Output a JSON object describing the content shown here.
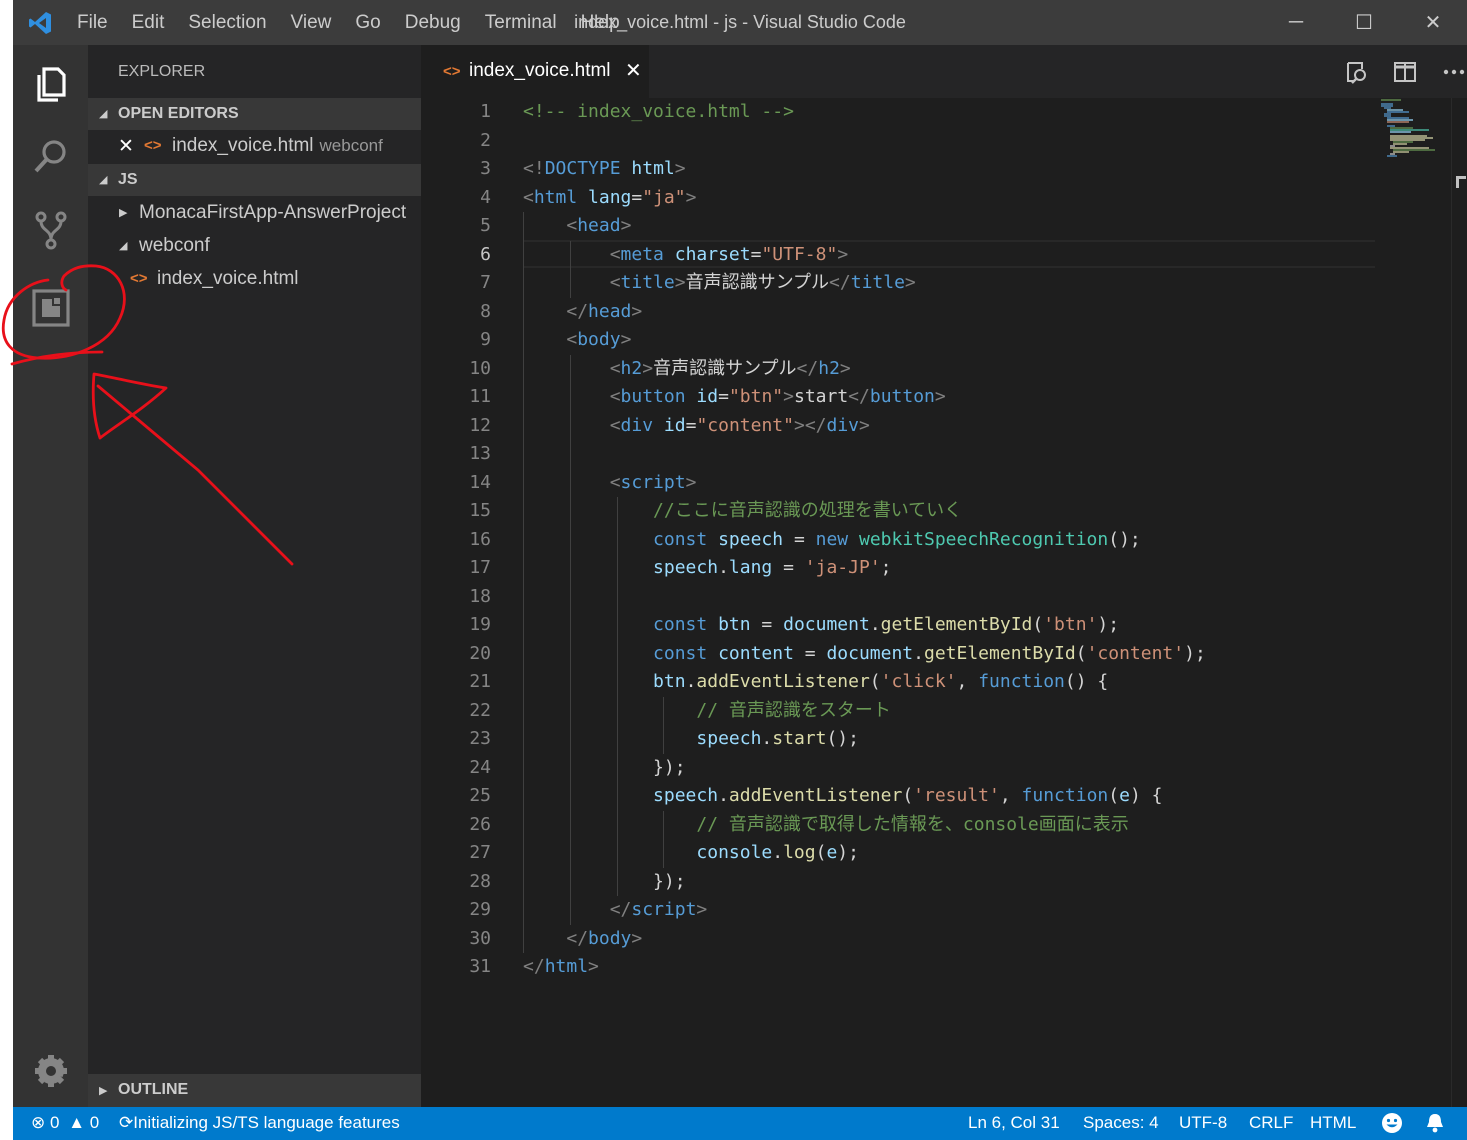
{
  "window": {
    "title": "index_voice.html - js - Visual Studio Code",
    "controls": {
      "minimize": "─",
      "maximize": "☐",
      "close": "✕"
    }
  },
  "menu": [
    "File",
    "Edit",
    "Selection",
    "View",
    "Go",
    "Debug",
    "Terminal",
    "Help"
  ],
  "activity_bar": {
    "items": [
      "explorer-icon",
      "search-icon",
      "source-control-icon",
      "extension-icon"
    ],
    "bottom": "gear-icon"
  },
  "sidebar": {
    "title": "EXPLORER",
    "open_editors": {
      "header": "OPEN EDITORS",
      "file": "index_voice.html",
      "folder": "webconf"
    },
    "workspace": {
      "header": "JS",
      "items": [
        {
          "label": "MonacaFirstApp-AnswerProject"
        },
        {
          "label": "webconf"
        },
        {
          "label": "index_voice.html"
        }
      ]
    },
    "outline": "OUTLINE"
  },
  "tab": {
    "label": "index_voice.html",
    "close": "✕",
    "file_icon": "<>"
  },
  "editor": {
    "current_line": 6,
    "line_numbers": [
      "1",
      "2",
      "3",
      "4",
      "5",
      "6",
      "7",
      "8",
      "9",
      "10",
      "11",
      "12",
      "13",
      "14",
      "15",
      "16",
      "17",
      "18",
      "19",
      "20",
      "21",
      "22",
      "23",
      "24",
      "25",
      "26",
      "27",
      "28",
      "29",
      "30",
      "31"
    ],
    "lines": [
      [
        [
          "cm",
          "<!-- index_voice.html -->"
        ]
      ],
      [],
      [
        [
          "tg",
          "<!"
        ],
        [
          "tn",
          "DOCTYPE"
        ],
        [
          "tx",
          " "
        ],
        [
          "at",
          "html"
        ],
        [
          "tg",
          ">"
        ]
      ],
      [
        [
          "tg",
          "<"
        ],
        [
          "tn",
          "html"
        ],
        [
          "tx",
          " "
        ],
        [
          "at",
          "lang"
        ],
        [
          "tx",
          "="
        ],
        [
          "st",
          "\"ja\""
        ],
        [
          "tg",
          ">"
        ]
      ],
      [
        [
          "tx",
          "    "
        ],
        [
          "tg",
          "<"
        ],
        [
          "tn",
          "head"
        ],
        [
          "tg",
          ">"
        ]
      ],
      [
        [
          "tx",
          "        "
        ],
        [
          "tg",
          "<"
        ],
        [
          "tn",
          "meta"
        ],
        [
          "tx",
          " "
        ],
        [
          "at",
          "charset"
        ],
        [
          "tx",
          "="
        ],
        [
          "st",
          "\"UTF-8\""
        ],
        [
          "tg",
          ">"
        ]
      ],
      [
        [
          "tx",
          "        "
        ],
        [
          "tg",
          "<"
        ],
        [
          "tn",
          "title"
        ],
        [
          "tg",
          ">"
        ],
        [
          "tx",
          "音声認識サンプル"
        ],
        [
          "tg",
          "</"
        ],
        [
          "tn",
          "title"
        ],
        [
          "tg",
          ">"
        ]
      ],
      [
        [
          "tx",
          "    "
        ],
        [
          "tg",
          "</"
        ],
        [
          "tn",
          "head"
        ],
        [
          "tg",
          ">"
        ]
      ],
      [
        [
          "tx",
          "    "
        ],
        [
          "tg",
          "<"
        ],
        [
          "tn",
          "body"
        ],
        [
          "tg",
          ">"
        ]
      ],
      [
        [
          "tx",
          "        "
        ],
        [
          "tg",
          "<"
        ],
        [
          "tn",
          "h2"
        ],
        [
          "tg",
          ">"
        ],
        [
          "tx",
          "音声認識サンプル"
        ],
        [
          "tg",
          "</"
        ],
        [
          "tn",
          "h2"
        ],
        [
          "tg",
          ">"
        ]
      ],
      [
        [
          "tx",
          "        "
        ],
        [
          "tg",
          "<"
        ],
        [
          "tn",
          "button"
        ],
        [
          "tx",
          " "
        ],
        [
          "at",
          "id"
        ],
        [
          "tx",
          "="
        ],
        [
          "st",
          "\"btn\""
        ],
        [
          "tg",
          ">"
        ],
        [
          "tx",
          "start"
        ],
        [
          "tg",
          "</"
        ],
        [
          "tn",
          "button"
        ],
        [
          "tg",
          ">"
        ]
      ],
      [
        [
          "tx",
          "        "
        ],
        [
          "tg",
          "<"
        ],
        [
          "tn",
          "div"
        ],
        [
          "tx",
          " "
        ],
        [
          "at",
          "id"
        ],
        [
          "tx",
          "="
        ],
        [
          "st",
          "\"content\""
        ],
        [
          "tg",
          "></"
        ],
        [
          "tn",
          "div"
        ],
        [
          "tg",
          ">"
        ]
      ],
      [],
      [
        [
          "tx",
          "        "
        ],
        [
          "tg",
          "<"
        ],
        [
          "tn",
          "script"
        ],
        [
          "tg",
          ">"
        ]
      ],
      [
        [
          "tx",
          "            "
        ],
        [
          "cm",
          "//ここに音声認識の処理を書いていく"
        ]
      ],
      [
        [
          "tx",
          "            "
        ],
        [
          "kw",
          "const"
        ],
        [
          "tx",
          " "
        ],
        [
          "vr",
          "speech"
        ],
        [
          "tx",
          " = "
        ],
        [
          "kw",
          "new"
        ],
        [
          "tx",
          " "
        ],
        [
          "cl",
          "webkitSpeechRecognition"
        ],
        [
          "tx",
          "();"
        ]
      ],
      [
        [
          "tx",
          "            "
        ],
        [
          "vr",
          "speech"
        ],
        [
          "tx",
          "."
        ],
        [
          "vr",
          "lang"
        ],
        [
          "tx",
          " = "
        ],
        [
          "st",
          "'ja-JP'"
        ],
        [
          "tx",
          ";"
        ]
      ],
      [],
      [
        [
          "tx",
          "            "
        ],
        [
          "kw",
          "const"
        ],
        [
          "tx",
          " "
        ],
        [
          "vr",
          "btn"
        ],
        [
          "tx",
          " = "
        ],
        [
          "vr",
          "document"
        ],
        [
          "tx",
          "."
        ],
        [
          "fn",
          "getElementById"
        ],
        [
          "tx",
          "("
        ],
        [
          "st",
          "'btn'"
        ],
        [
          "tx",
          ");"
        ]
      ],
      [
        [
          "tx",
          "            "
        ],
        [
          "kw",
          "const"
        ],
        [
          "tx",
          " "
        ],
        [
          "vr",
          "content"
        ],
        [
          "tx",
          " = "
        ],
        [
          "vr",
          "document"
        ],
        [
          "tx",
          "."
        ],
        [
          "fn",
          "getElementById"
        ],
        [
          "tx",
          "("
        ],
        [
          "st",
          "'content'"
        ],
        [
          "tx",
          ");"
        ]
      ],
      [
        [
          "tx",
          "            "
        ],
        [
          "vr",
          "btn"
        ],
        [
          "tx",
          "."
        ],
        [
          "fn",
          "addEventListener"
        ],
        [
          "tx",
          "("
        ],
        [
          "st",
          "'click'"
        ],
        [
          "tx",
          ", "
        ],
        [
          "kw",
          "function"
        ],
        [
          "tx",
          "() {"
        ]
      ],
      [
        [
          "tx",
          "                "
        ],
        [
          "cm",
          "// 音声認識をスタート"
        ]
      ],
      [
        [
          "tx",
          "                "
        ],
        [
          "vr",
          "speech"
        ],
        [
          "tx",
          "."
        ],
        [
          "fn",
          "start"
        ],
        [
          "tx",
          "();"
        ]
      ],
      [
        [
          "tx",
          "            });"
        ]
      ],
      [
        [
          "tx",
          "            "
        ],
        [
          "vr",
          "speech"
        ],
        [
          "tx",
          "."
        ],
        [
          "fn",
          "addEventListener"
        ],
        [
          "tx",
          "("
        ],
        [
          "st",
          "'result'"
        ],
        [
          "tx",
          ", "
        ],
        [
          "kw",
          "function"
        ],
        [
          "tx",
          "("
        ],
        [
          "vr",
          "e"
        ],
        [
          "tx",
          ") {"
        ]
      ],
      [
        [
          "tx",
          "                "
        ],
        [
          "cm",
          "// 音声認識で取得した情報を、console画面に表示"
        ]
      ],
      [
        [
          "tx",
          "                "
        ],
        [
          "vr",
          "console"
        ],
        [
          "tx",
          "."
        ],
        [
          "fn",
          "log"
        ],
        [
          "tx",
          "("
        ],
        [
          "vr",
          "e"
        ],
        [
          "tx",
          ");"
        ]
      ],
      [
        [
          "tx",
          "            });"
        ]
      ],
      [
        [
          "tx",
          "        "
        ],
        [
          "tg",
          "</"
        ],
        [
          "tn",
          "script"
        ],
        [
          "tg",
          ">"
        ]
      ],
      [
        [
          "tx",
          "    "
        ],
        [
          "tg",
          "</"
        ],
        [
          "tn",
          "body"
        ],
        [
          "tg",
          ">"
        ]
      ],
      [
        [
          "tg",
          "</"
        ],
        [
          "tn",
          "html"
        ],
        [
          "tg",
          ">"
        ]
      ]
    ]
  },
  "status": {
    "errors": "0",
    "warnings": "0",
    "message": "Initializing JS/TS language features",
    "position": "Ln 6, Col 31",
    "spaces": "Spaces: 4",
    "encoding": "UTF-8",
    "eol": "CRLF",
    "language": "HTML"
  },
  "colors": {
    "titlebar": "#3c3c3c",
    "activitybar": "#333333",
    "sidebar": "#252526",
    "editor": "#1e1e1e",
    "statusbar": "#007acc",
    "annotation": "#e8101a"
  }
}
